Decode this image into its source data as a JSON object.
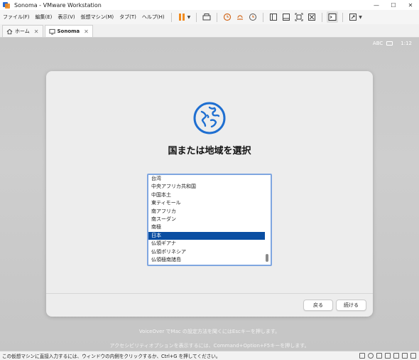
{
  "window": {
    "title": "Sonoma - VMware Workstation",
    "minimize": "—",
    "maximize": "☐",
    "close": "✕"
  },
  "menu": [
    "ファイル(F)",
    "編集(E)",
    "表示(V)",
    "仮想マシン(M)",
    "タブ(T)",
    "ヘルプ(H)"
  ],
  "tabs": [
    {
      "label": "ホーム"
    },
    {
      "label": "Sonoma"
    }
  ],
  "vm_status": {
    "input_source": "ABC",
    "time": "1:12"
  },
  "dialog": {
    "title": "国または地域を選択",
    "items": [
      "台湾",
      "中央アフリカ共和国",
      "中国本土",
      "東ティモール",
      "南アフリカ",
      "南スーダン",
      "南極",
      "日本",
      "仏領ギアナ",
      "仏領ポリネシア",
      "仏領極南諸島"
    ],
    "selected_item": "日本",
    "back_label": "戻る",
    "continue_label": "続ける"
  },
  "hints": {
    "voiceover": "VoiceOver でMac の設定方法を聞くにはEscキーを押します。",
    "accessibility": "アクセシビリティオプションを表示するには、Command+Option+F5キーを押します。"
  },
  "statusbar": {
    "message": "この仮想マシンに直接入力するには、ウィンドウの内側をクリックするか、Ctrl+G を押してください。"
  },
  "colors": {
    "accent_blue": "#0a4ea2",
    "pause_orange": "#f08a1c",
    "globe_blue": "#1f6fd1"
  }
}
